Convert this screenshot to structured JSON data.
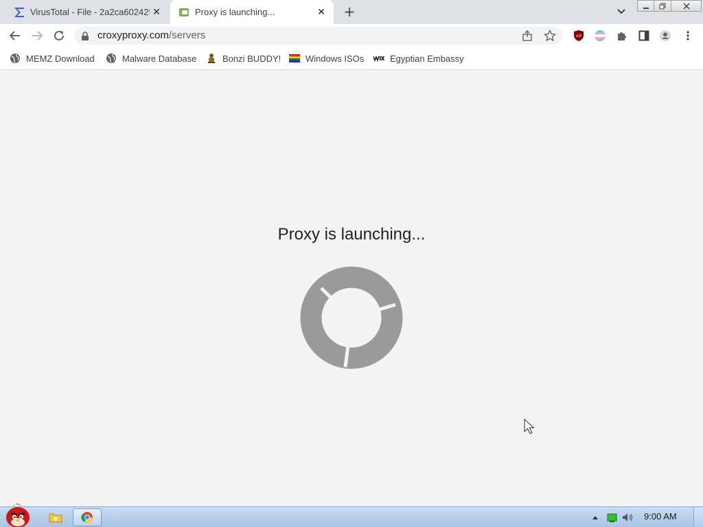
{
  "browser": {
    "tabs": [
      {
        "title": "VirusTotal - File - 2a2ca602425",
        "favicon": "virustotal-sigma-icon",
        "active": false
      },
      {
        "title": "Proxy is launching...",
        "favicon": "croxyproxy-icon",
        "active": true
      }
    ],
    "new_tab_label": "+",
    "address": {
      "host": "croxyproxy.com",
      "path": "/servers"
    },
    "bookmarks": [
      {
        "label": "MEMZ Download",
        "icon": "globe-icon"
      },
      {
        "label": "Malware Database",
        "icon": "globe-icon"
      },
      {
        "label": "Bonzi BUDDY!",
        "icon": "bonzi-icon"
      },
      {
        "label": "Windows ISOs",
        "icon": "rainbow-flag-icon"
      },
      {
        "label": "Egyptian Embassy",
        "icon": "wix-icon"
      }
    ],
    "extensions": [
      "ublock-icon",
      "trans-flag-icon",
      "puzzle-icon",
      "side-panel-icon",
      "profile-icon",
      "menu-icon"
    ]
  },
  "page": {
    "heading": "Proxy is launching...",
    "spinner_color": "#9a9a9a"
  },
  "taskbar": {
    "clock": "9:00 AM",
    "items": [
      "start-orb-angry-bird-icon",
      "folder-icon",
      "chrome-icon"
    ],
    "tray": [
      "tray-up-arrow-icon",
      "battery-icon",
      "volume-icon"
    ]
  },
  "colors": {
    "tabstrip": "#dee1e6",
    "omnibox": "#f1f3f4",
    "page_bg": "#f3f3f3",
    "taskbar": "#b9d1ee"
  }
}
